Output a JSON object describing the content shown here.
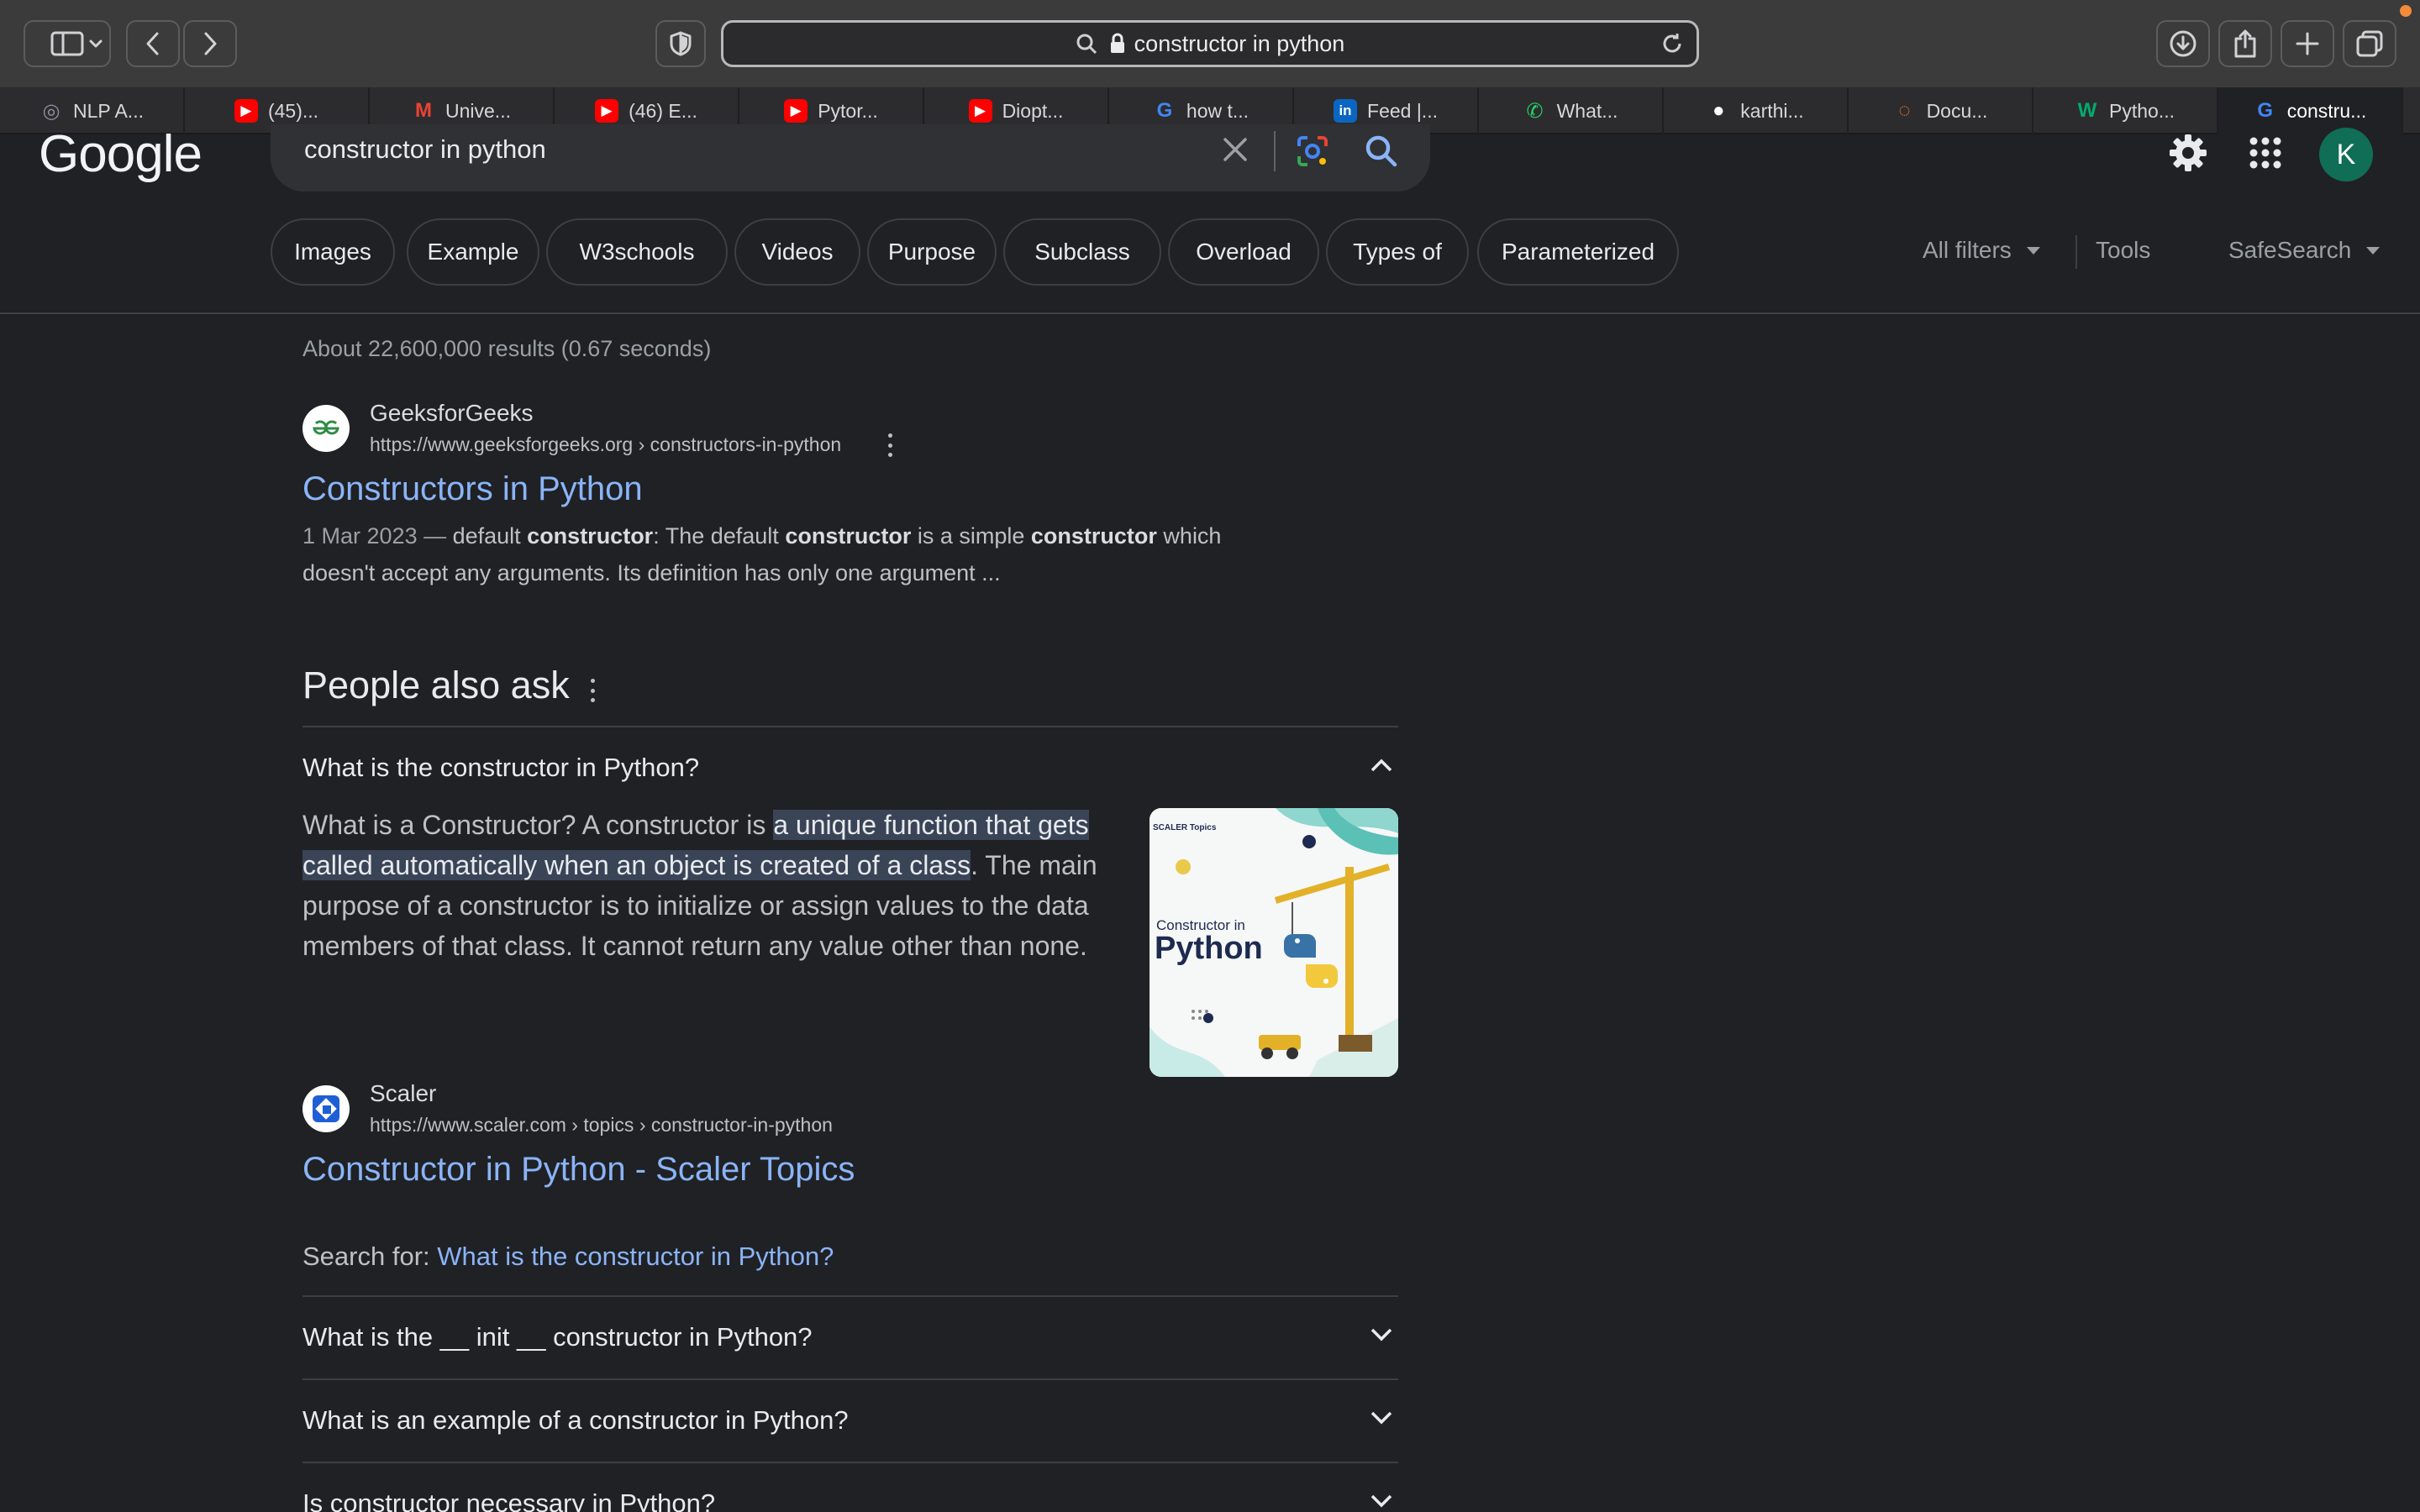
{
  "browser": {
    "address": "constructor in python",
    "tabs": [
      {
        "label": "NLP A...",
        "icon": "openai-icon",
        "color": "#8e8ea0"
      },
      {
        "label": "(45)...",
        "icon": "youtube-icon",
        "color": "#ff0000"
      },
      {
        "label": "Unive...",
        "icon": "gmail-icon",
        "color": "#ea4335"
      },
      {
        "label": "(46) E...",
        "icon": "youtube-icon",
        "color": "#ff0000"
      },
      {
        "label": "Pytor...",
        "icon": "youtube-icon",
        "color": "#ff0000"
      },
      {
        "label": "Diopt...",
        "icon": "youtube-icon",
        "color": "#ff0000"
      },
      {
        "label": "how t...",
        "icon": "google-icon",
        "color": "#4285f4"
      },
      {
        "label": "Feed |...",
        "icon": "linkedin-icon",
        "color": "#0a66c2"
      },
      {
        "label": "What...",
        "icon": "whatsapp-icon",
        "color": "#25d366"
      },
      {
        "label": "karthi...",
        "icon": "github-icon",
        "color": "#ffffff"
      },
      {
        "label": "Docu...",
        "icon": "jupyter-icon",
        "color": "#f37626"
      },
      {
        "label": "Pytho...",
        "icon": "w3-icon",
        "color": "#04aa6d"
      },
      {
        "label": "constru...",
        "icon": "google-icon",
        "color": "#4285f4"
      }
    ]
  },
  "google": {
    "logo": "Google",
    "query": "constructor in python",
    "avatar_letter": "K",
    "chips": [
      "Images",
      "Example",
      "W3schools",
      "Videos",
      "Purpose",
      "Subclass",
      "Overload",
      "Types of",
      "Parameterized"
    ],
    "all_filters": "All filters",
    "tools": "Tools",
    "safesearch": "SafeSearch"
  },
  "results": {
    "stats": "About 22,600,000 results (0.67 seconds)",
    "first": {
      "site": "GeeksforGeeks",
      "url": "https://www.geeksforgeeks.org › constructors-in-python",
      "title": "Constructors in Python",
      "snippet_date": "1 Mar 2023 — ",
      "snippet_p1": "default ",
      "snippet_b1": "constructor",
      "snippet_p2": ": The default ",
      "snippet_b2": "constructor",
      "snippet_p3": " is a simple ",
      "snippet_b3": "constructor",
      "snippet_p4": " which doesn't accept any arguments. Its definition has only one argument ..."
    }
  },
  "paa": {
    "title": "People also ask",
    "q1": "What is the constructor in Python?",
    "answer_pre": "What is a Constructor? A constructor is ",
    "answer_hl": "a unique function that gets called automatically when an object is created of a class",
    "answer_post": ". The main purpose of a constructor is to initialize or assign values to the data members of that class. It cannot return any value other than none.",
    "image_brand": "SCALER Topics",
    "image_line1": "Constructor in",
    "image_line2": "Python",
    "source_site": "Scaler",
    "source_url": "https://www.scaler.com › topics › constructor-in-python",
    "source_title": "Constructor in Python - Scaler Topics",
    "search_for_label": "Search for: ",
    "search_for_link": "What is the constructor in Python?",
    "q2": "What is the __ init __ constructor in Python?",
    "q3": "What is an example of a constructor in Python?",
    "q4": "Is constructor necessary in Python?"
  }
}
